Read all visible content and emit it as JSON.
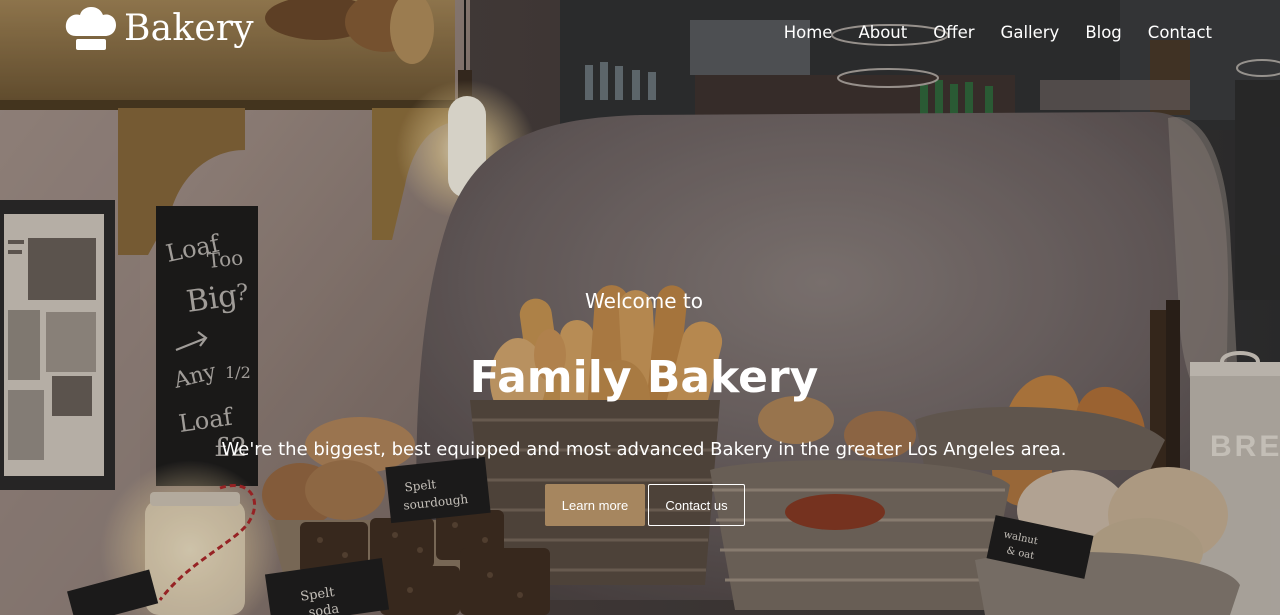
{
  "header": {
    "brand_name": "Bakery",
    "brand_icon": "chef-hat-icon",
    "nav": [
      "Home",
      "About",
      "Offer",
      "Gallery",
      "Blog",
      "Contact"
    ]
  },
  "hero": {
    "welcome": "Welcome to",
    "title": "Family Bakery",
    "tagline": "We're the biggest, best equipped and most advanced Bakery in the greater Los Angeles area.",
    "primary_button": "Learn more",
    "secondary_button": "Contact us"
  },
  "scene_text": {
    "chalkboard": [
      "Loaf",
      "Too",
      "Big",
      "?",
      "Any",
      "1/2",
      "Loaf",
      "£2"
    ],
    "sign_sourdough": [
      "Spelt",
      "sourdough"
    ],
    "sign_spelt": [
      "Spelt",
      "soda"
    ],
    "sign_walnut": [
      "walnut",
      "& oat"
    ],
    "tin_label": "BRE"
  },
  "colors": {
    "primary_button": "#a6865f",
    "text": "#ffffff"
  }
}
